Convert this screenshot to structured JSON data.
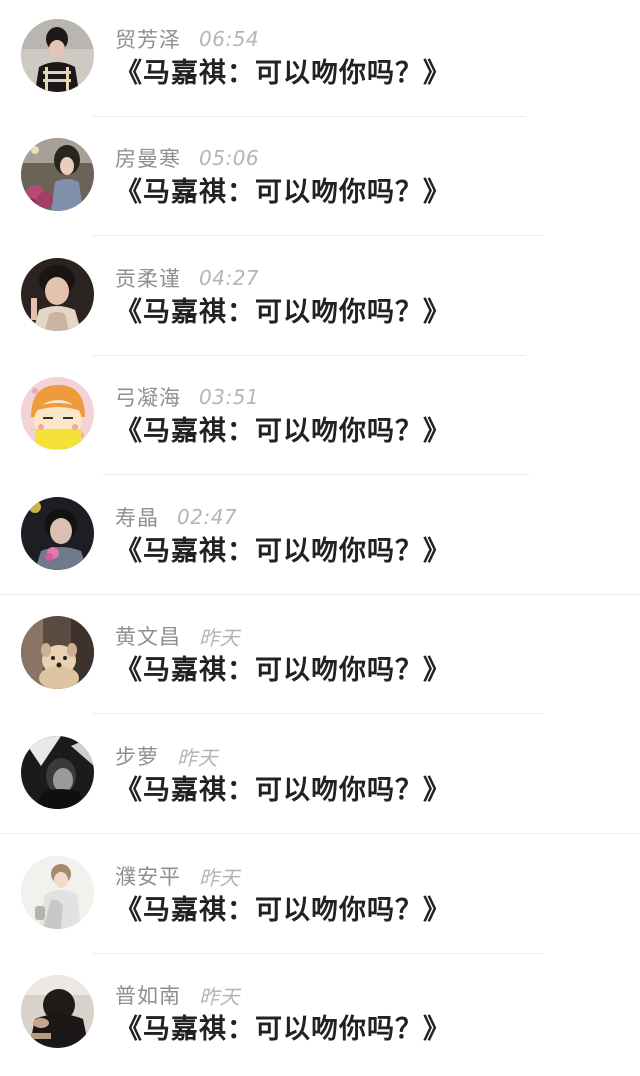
{
  "conversations": [
    {
      "sender": "贸芳泽",
      "time": "06:54",
      "message": "《马嘉祺：可以吻你吗？》",
      "avatar": "girl-dark-hair-icon"
    },
    {
      "sender": "房曼寒",
      "time": "05:06",
      "message": "《马嘉祺：可以吻你吗？》",
      "avatar": "girl-flowers-icon"
    },
    {
      "sender": "贡柔谨",
      "time": "04:27",
      "message": "《马嘉祺：可以吻你吗？》",
      "avatar": "boy-portrait-icon"
    },
    {
      "sender": "弓凝海",
      "time": "03:51",
      "message": "《马嘉祺：可以吻你吗？》",
      "avatar": "cartoon-face-icon"
    },
    {
      "sender": "寿晶",
      "time": "02:47",
      "message": "《马嘉祺：可以吻你吗？》",
      "avatar": "boy-flower-icon"
    },
    {
      "sender": "黄文昌",
      "time": "昨天",
      "message": "《马嘉祺：可以吻你吗？》",
      "avatar": "dog-icon"
    },
    {
      "sender": "步萝",
      "time": "昨天",
      "message": "《马嘉祺：可以吻你吗？》",
      "avatar": "monochrome-portrait-icon"
    },
    {
      "sender": "濮安平",
      "time": "昨天",
      "message": "《马嘉祺：可以吻你吗？》",
      "avatar": "white-coat-girl-icon"
    },
    {
      "sender": "普如南",
      "time": "昨天",
      "message": "《马嘉祺：可以吻你吗？》",
      "avatar": "dark-figure-icon"
    }
  ],
  "colors": {
    "background": "#ffffff",
    "sender_text": "#8f8f8f",
    "time_text": "#b5b5b5",
    "message_text": "#222222",
    "divider": "#ececec"
  }
}
